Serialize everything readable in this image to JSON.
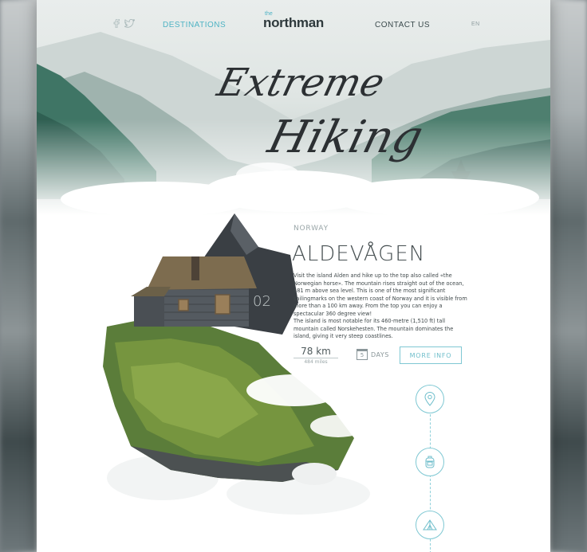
{
  "nav": {
    "social_icons": [
      "facebook-icon",
      "twitter-icon"
    ],
    "destinations": "DESTINATIONS",
    "contact": "CONTACT US",
    "language": "EN"
  },
  "logo": {
    "small": "the",
    "main": "northman"
  },
  "hero": {
    "title_line1": "Extreme",
    "title_line2": "Hiking"
  },
  "destination": {
    "country": "NORWAY",
    "name": "ALDEVÅGEN",
    "number": "02",
    "description_p1": "Visit the island Alden and hike up to the top also called «the Norwegian horse». The mountain rises straight out of the ocean, 481 m above sea level. This is one of the most significant sailingmarks on the western coast of Norway and it is visible from more than a 100 km away. From the top you can enjoy a spectacular 360 degree view!",
    "description_p2": "The island is most notable for its 460-metre (1,510 ft) tall mountain called Norskehesten. The mountain dominates the island, giving it very steep coastlines.",
    "distance_km": "78 km",
    "distance_miles": "484 miles",
    "days_number": "5",
    "days_label": "DAYS",
    "more_info": "MORE INFO"
  },
  "timeline": [
    "location-pin-icon",
    "backpack-icon",
    "tent-icon"
  ],
  "colors": {
    "accent": "#4fb3c4",
    "dark_text": "#2f3a3d",
    "forest": "#2f5f52"
  }
}
